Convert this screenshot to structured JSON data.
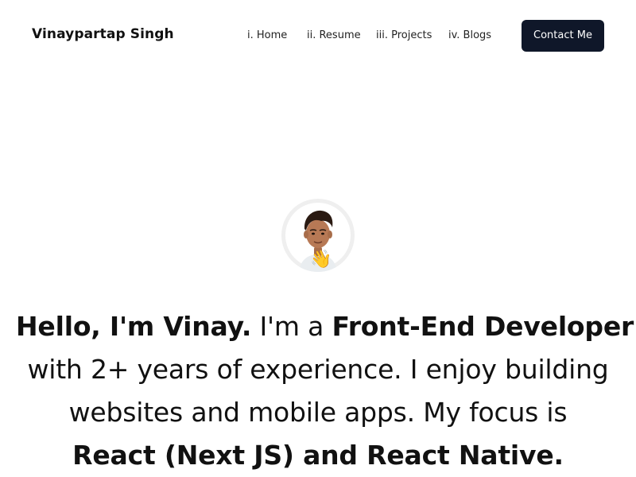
{
  "header": {
    "brand": "Vinaypartap Singh",
    "nav": [
      {
        "label": "i. Home"
      },
      {
        "label": "ii. Resume"
      },
      {
        "label": "iii. Projects"
      },
      {
        "label": "iv. Blogs"
      }
    ],
    "contact_label": "Contact Me"
  },
  "colors": {
    "button_bg": "#0f1729",
    "button_text": "#ffffff",
    "text": "#111111",
    "avatar_ring": "#efefef"
  },
  "hero": {
    "avatar_icon": "profile-photo",
    "wave_emoji": "👋",
    "greeting": "Hello, I'm Vinay.",
    "intro_mid": " I'm a ",
    "role": "Front-End Developer",
    "line2": "with 2+ years of experience. I enjoy building",
    "line3": "websites and mobile apps. My focus is",
    "focus": "React (Next JS) and React Native."
  }
}
